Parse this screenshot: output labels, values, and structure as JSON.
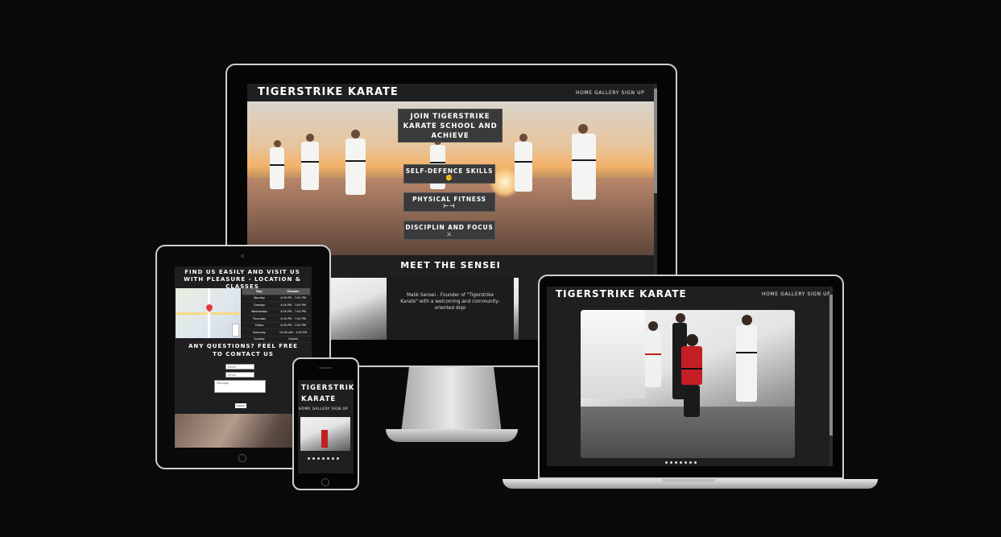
{
  "brand": "TIGERSTRIKE KARATE",
  "brand_line1": "TIGERSTRIKE",
  "brand_line2": "KARATE",
  "nav": {
    "home": "HOME",
    "gallery": "GALLERY",
    "signup": "SIGN UP"
  },
  "hero": {
    "join": "JOIN TIGERSTRIKE KARATE SCHOOL AND ACHIEVE",
    "features": [
      {
        "label": "SELF-DEFENCE SKILLS",
        "icon": "fist-icon"
      },
      {
        "label": "PHYSICAL FITNESS",
        "icon": "dumbbell-icon"
      },
      {
        "label": "DISCIPLIN AND FOCUS",
        "icon": "crossed-swords-icon"
      }
    ]
  },
  "sensei": {
    "heading": "MEET THE SENSEI",
    "text": "Malik Sensei - Founder of \"Tigerstrike Karate\" with a welcoming and community-oriented dojo"
  },
  "location": {
    "heading": "FIND US EASILY AND VISIT US WITH PLEASURE - LOCATION & CLASSES",
    "table_headers": [
      "Day",
      "Classes"
    ],
    "table_rows": [
      [
        "Monday",
        "4:00 PM - 7:00 PM"
      ],
      [
        "Tuesday",
        "4:00 PM - 7:00 PM"
      ],
      [
        "Wednesday",
        "4:00 PM - 7:00 PM"
      ],
      [
        "Thursday",
        "4:00 PM - 7:00 PM"
      ],
      [
        "Friday",
        "4:00 PM - 7:00 PM"
      ],
      [
        "Saturday",
        "10:00 AM - 1:00 PM"
      ],
      [
        "Sunday",
        "Closed"
      ]
    ]
  },
  "contact": {
    "heading": "ANY QUESTIONS? FEEL FREE TO CONTACT US",
    "name_placeholder": "Name",
    "email_placeholder": "Email",
    "message_placeholder": "Message",
    "submit": "Submit"
  },
  "colors": {
    "background": "#0a0a0b",
    "page": "#1f1f21",
    "card": "#3a3a3c"
  }
}
